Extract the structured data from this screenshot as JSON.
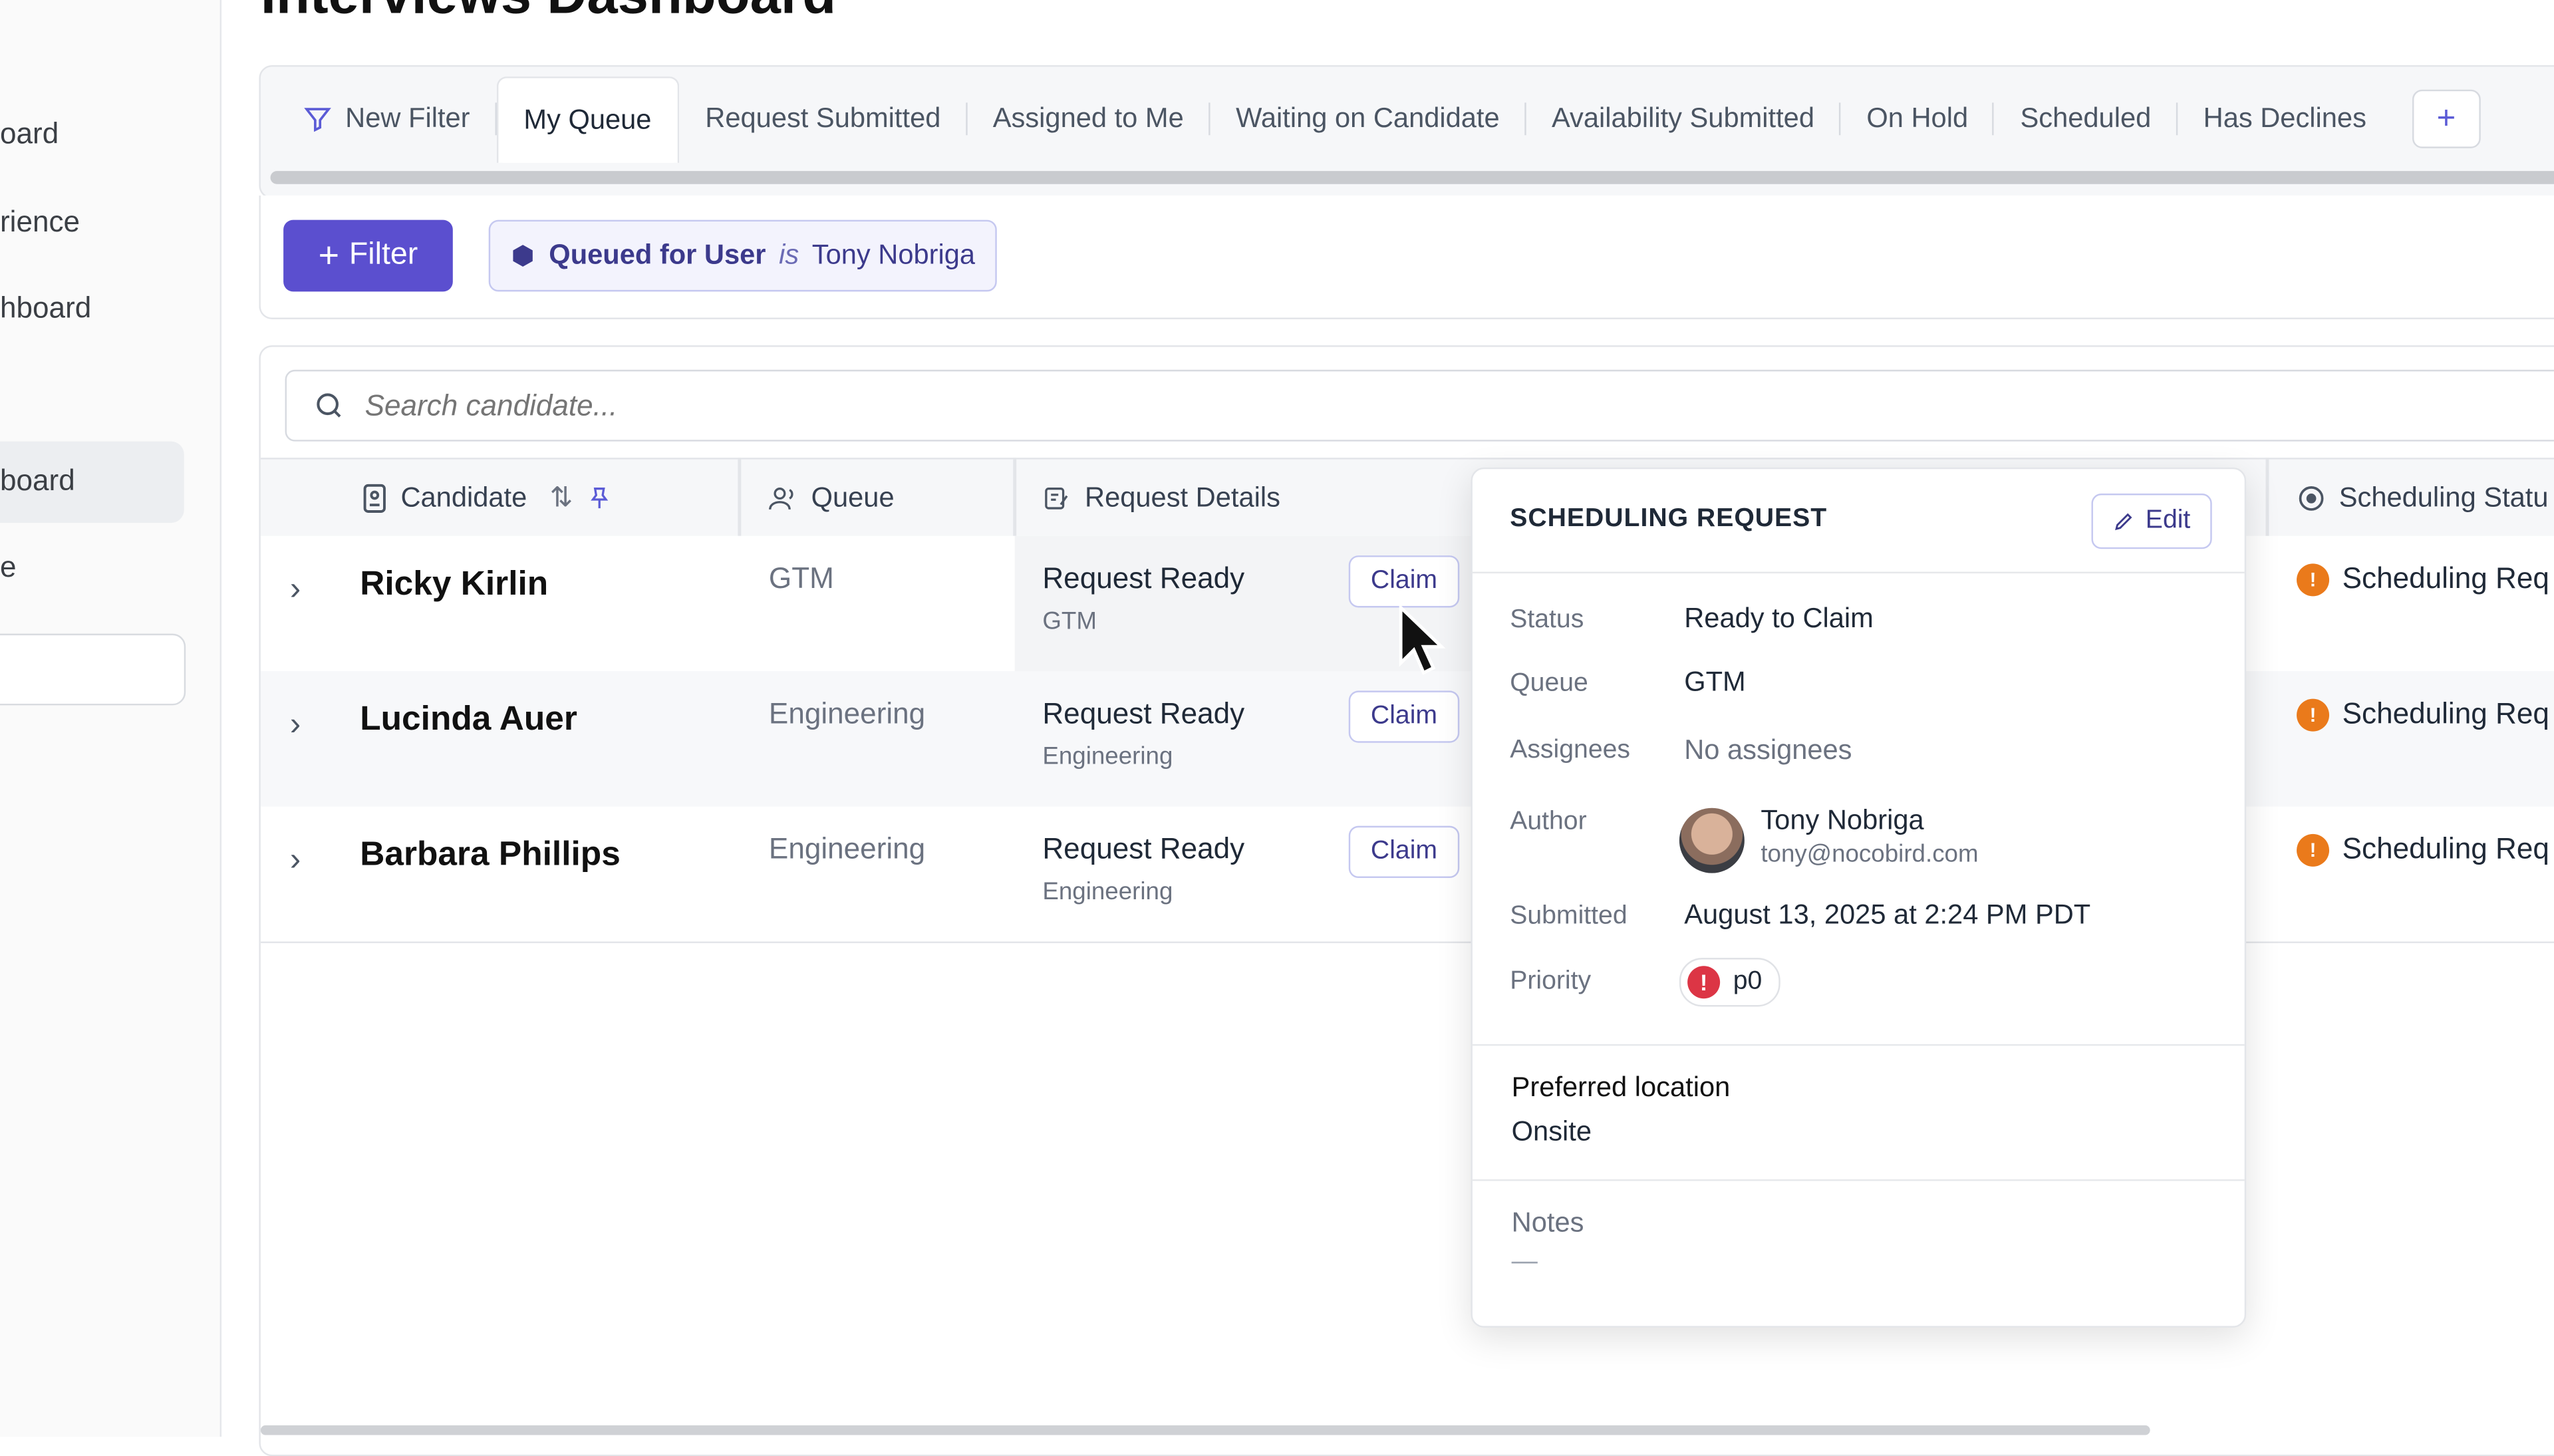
{
  "page": {
    "title": "Interviews Dashboard"
  },
  "sidebar": {
    "items": [
      {
        "label": "oard"
      },
      {
        "label": "rience"
      },
      {
        "label": "hboard"
      },
      {
        "label": "board"
      },
      {
        "label": "e"
      }
    ]
  },
  "tabs": {
    "new_filter": "New Filter",
    "items": [
      {
        "label": "My Queue"
      },
      {
        "label": "Request Submitted"
      },
      {
        "label": "Assigned to Me"
      },
      {
        "label": "Waiting on Candidate"
      },
      {
        "label": "Availability Submitted"
      },
      {
        "label": "On Hold"
      },
      {
        "label": "Scheduled"
      },
      {
        "label": "Has Declines"
      }
    ],
    "add": "+"
  },
  "filterbar": {
    "filter_button": "Filter",
    "chip": {
      "field": "Queued for User",
      "operator": "is",
      "value": "Tony Nobriga"
    }
  },
  "search": {
    "placeholder": "Search candidate..."
  },
  "table": {
    "headers": {
      "candidate": "Candidate",
      "queue": "Queue",
      "request_details": "Request Details",
      "scheduling_status": "Scheduling Statu"
    },
    "rows": [
      {
        "candidate": "Ricky Kirlin",
        "queue": "GTM",
        "request": "Request Ready",
        "request_sub": "GTM",
        "claim": "Claim",
        "status": "Scheduling Req"
      },
      {
        "candidate": "Lucinda Auer",
        "queue": "Engineering",
        "request": "Request Ready",
        "request_sub": "Engineering",
        "claim": "Claim",
        "status": "Scheduling Req"
      },
      {
        "candidate": "Barbara Phillips",
        "queue": "Engineering",
        "request": "Request Ready",
        "request_sub": "Engineering",
        "claim": "Claim",
        "status": "Scheduling Req"
      }
    ]
  },
  "popover": {
    "title": "SCHEDULING REQUEST",
    "edit": "Edit",
    "labels": {
      "status": "Status",
      "queue": "Queue",
      "assignees": "Assignees",
      "author": "Author",
      "submitted": "Submitted",
      "priority": "Priority"
    },
    "values": {
      "status": "Ready to Claim",
      "queue": "GTM",
      "assignees": "No assignees",
      "author_name": "Tony Nobriga",
      "author_email": "tony@nocobird.com",
      "submitted": "August 13, 2025 at 2:24 PM PDT",
      "priority": "p0"
    },
    "preferred_location_label": "Preferred location",
    "preferred_location": "Onsite",
    "notes_label": "Notes",
    "notes": "—"
  },
  "colors": {
    "accent": "#5b4fcf",
    "warning": "#ea7a1b",
    "danger": "#dc3545"
  }
}
